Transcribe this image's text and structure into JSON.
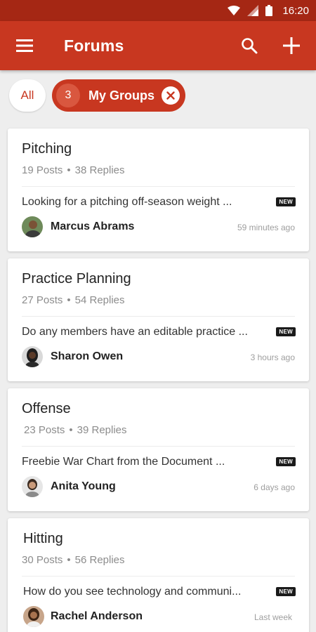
{
  "status_bar": {
    "time": "16:20"
  },
  "app_bar": {
    "title": "Forums"
  },
  "filters": {
    "all_label": "All",
    "groups_count": "3",
    "groups_label": "My Groups"
  },
  "accent_color": "#c83720",
  "forums": [
    {
      "title": "Pitching",
      "posts": "19 Posts",
      "replies": "38 Replies",
      "preview": "Looking for a pitching off-season weight ...",
      "badge": "NEW",
      "author": "Marcus Abrams",
      "time": "59 minutes ago"
    },
    {
      "title": "Practice Planning",
      "posts": "27 Posts",
      "replies": "54 Replies",
      "preview": "Do any members have an editable practice ...",
      "badge": "NEW",
      "author": "Sharon Owen",
      "time": "3 hours ago"
    },
    {
      "title": "Offense",
      "posts": "23 Posts",
      "replies": "39 Replies",
      "preview": "Freebie War Chart from the Document ...",
      "badge": "NEW",
      "author": "Anita Young",
      "time": "6 days ago"
    },
    {
      "title": "Hitting",
      "posts": "30 Posts",
      "replies": "56 Replies",
      "preview": "How do you see technology and communi...",
      "badge": "NEW",
      "author": "Rachel Anderson",
      "time": "Last week"
    }
  ]
}
